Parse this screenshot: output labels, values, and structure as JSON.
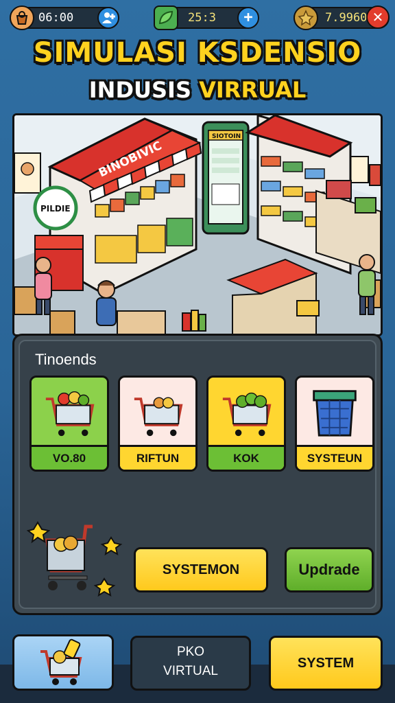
{
  "hud": {
    "time": "06:00",
    "leaf_count": "25:3",
    "gold": "7.9960",
    "icons": [
      "bag-icon",
      "leaf-icon",
      "gold-icon",
      "plus-icon",
      "close-icon"
    ]
  },
  "title": {
    "line1": "SIMULASI KSDENSIO",
    "line2_word1": "INDUSIS",
    "line2_word2": "VIRRUAL"
  },
  "scene": {
    "store_sign": "BINOBIVIC",
    "booth_sign": "PILDIE",
    "phone_header": "SIOTOIN"
  },
  "panel": {
    "title": "Tinoends",
    "cards": [
      {
        "label": "VO.80",
        "color": "#8cd14b"
      },
      {
        "label": "RIFTUN",
        "color": "#ffd630"
      },
      {
        "label": "KOK",
        "color": "#8cd14b"
      },
      {
        "label": "SYSTEUN",
        "color": "#ffd630"
      }
    ],
    "systemon_label": "SYSTEMON",
    "upgrade_label": "Updrade"
  },
  "bottom": {
    "middle_line1": "PKO",
    "middle_line2": "VIRTUAL",
    "system_label": "SYSTEM"
  },
  "colors": {
    "accent_yellow": "#ffd21f",
    "accent_green": "#6cbf35",
    "accent_blue": "#2f8fe0",
    "danger_red": "#e23c2c"
  }
}
